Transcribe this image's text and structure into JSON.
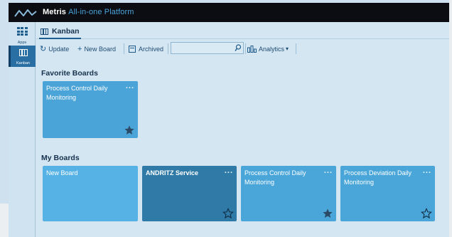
{
  "app": {
    "name": "Metris",
    "subtitle": "All-in-one Platform"
  },
  "sidebar": {
    "items": [
      {
        "label": "Apps",
        "icon": "grid-icon"
      },
      {
        "label": "Kanban",
        "icon": "kanban-icon",
        "active": true
      }
    ]
  },
  "tab": {
    "label": "Kanban"
  },
  "toolbar": {
    "update_label": "Update",
    "new_board_label": "New Board",
    "archived_label": "Archived",
    "search_value": "",
    "search_placeholder": "",
    "analytics_label": "Analytics"
  },
  "sections": {
    "favorites_title": "Favorite Boards",
    "my_boards_title": "My Boards"
  },
  "favorite_boards": [
    {
      "title": "Process Control Daily Monitoring",
      "more": "...",
      "starred": true
    }
  ],
  "my_boards": [
    {
      "title": "New Board",
      "more": "",
      "starred": null
    },
    {
      "title": "ANDRITZ Service",
      "more": "...",
      "starred": false
    },
    {
      "title": "Process Control Daily Monitoring",
      "more": "...",
      "starred": true
    },
    {
      "title": "Process Deviation Daily Monitoring",
      "more": "...",
      "starred": false
    }
  ],
  "colors": {
    "topbar": "#0b0d12",
    "brand_accent": "#4aa3da",
    "card_light": "#56b2e4",
    "card_medium": "#4aa6d9",
    "card_dark": "#2f7aa6",
    "star": "#2b4a66"
  }
}
